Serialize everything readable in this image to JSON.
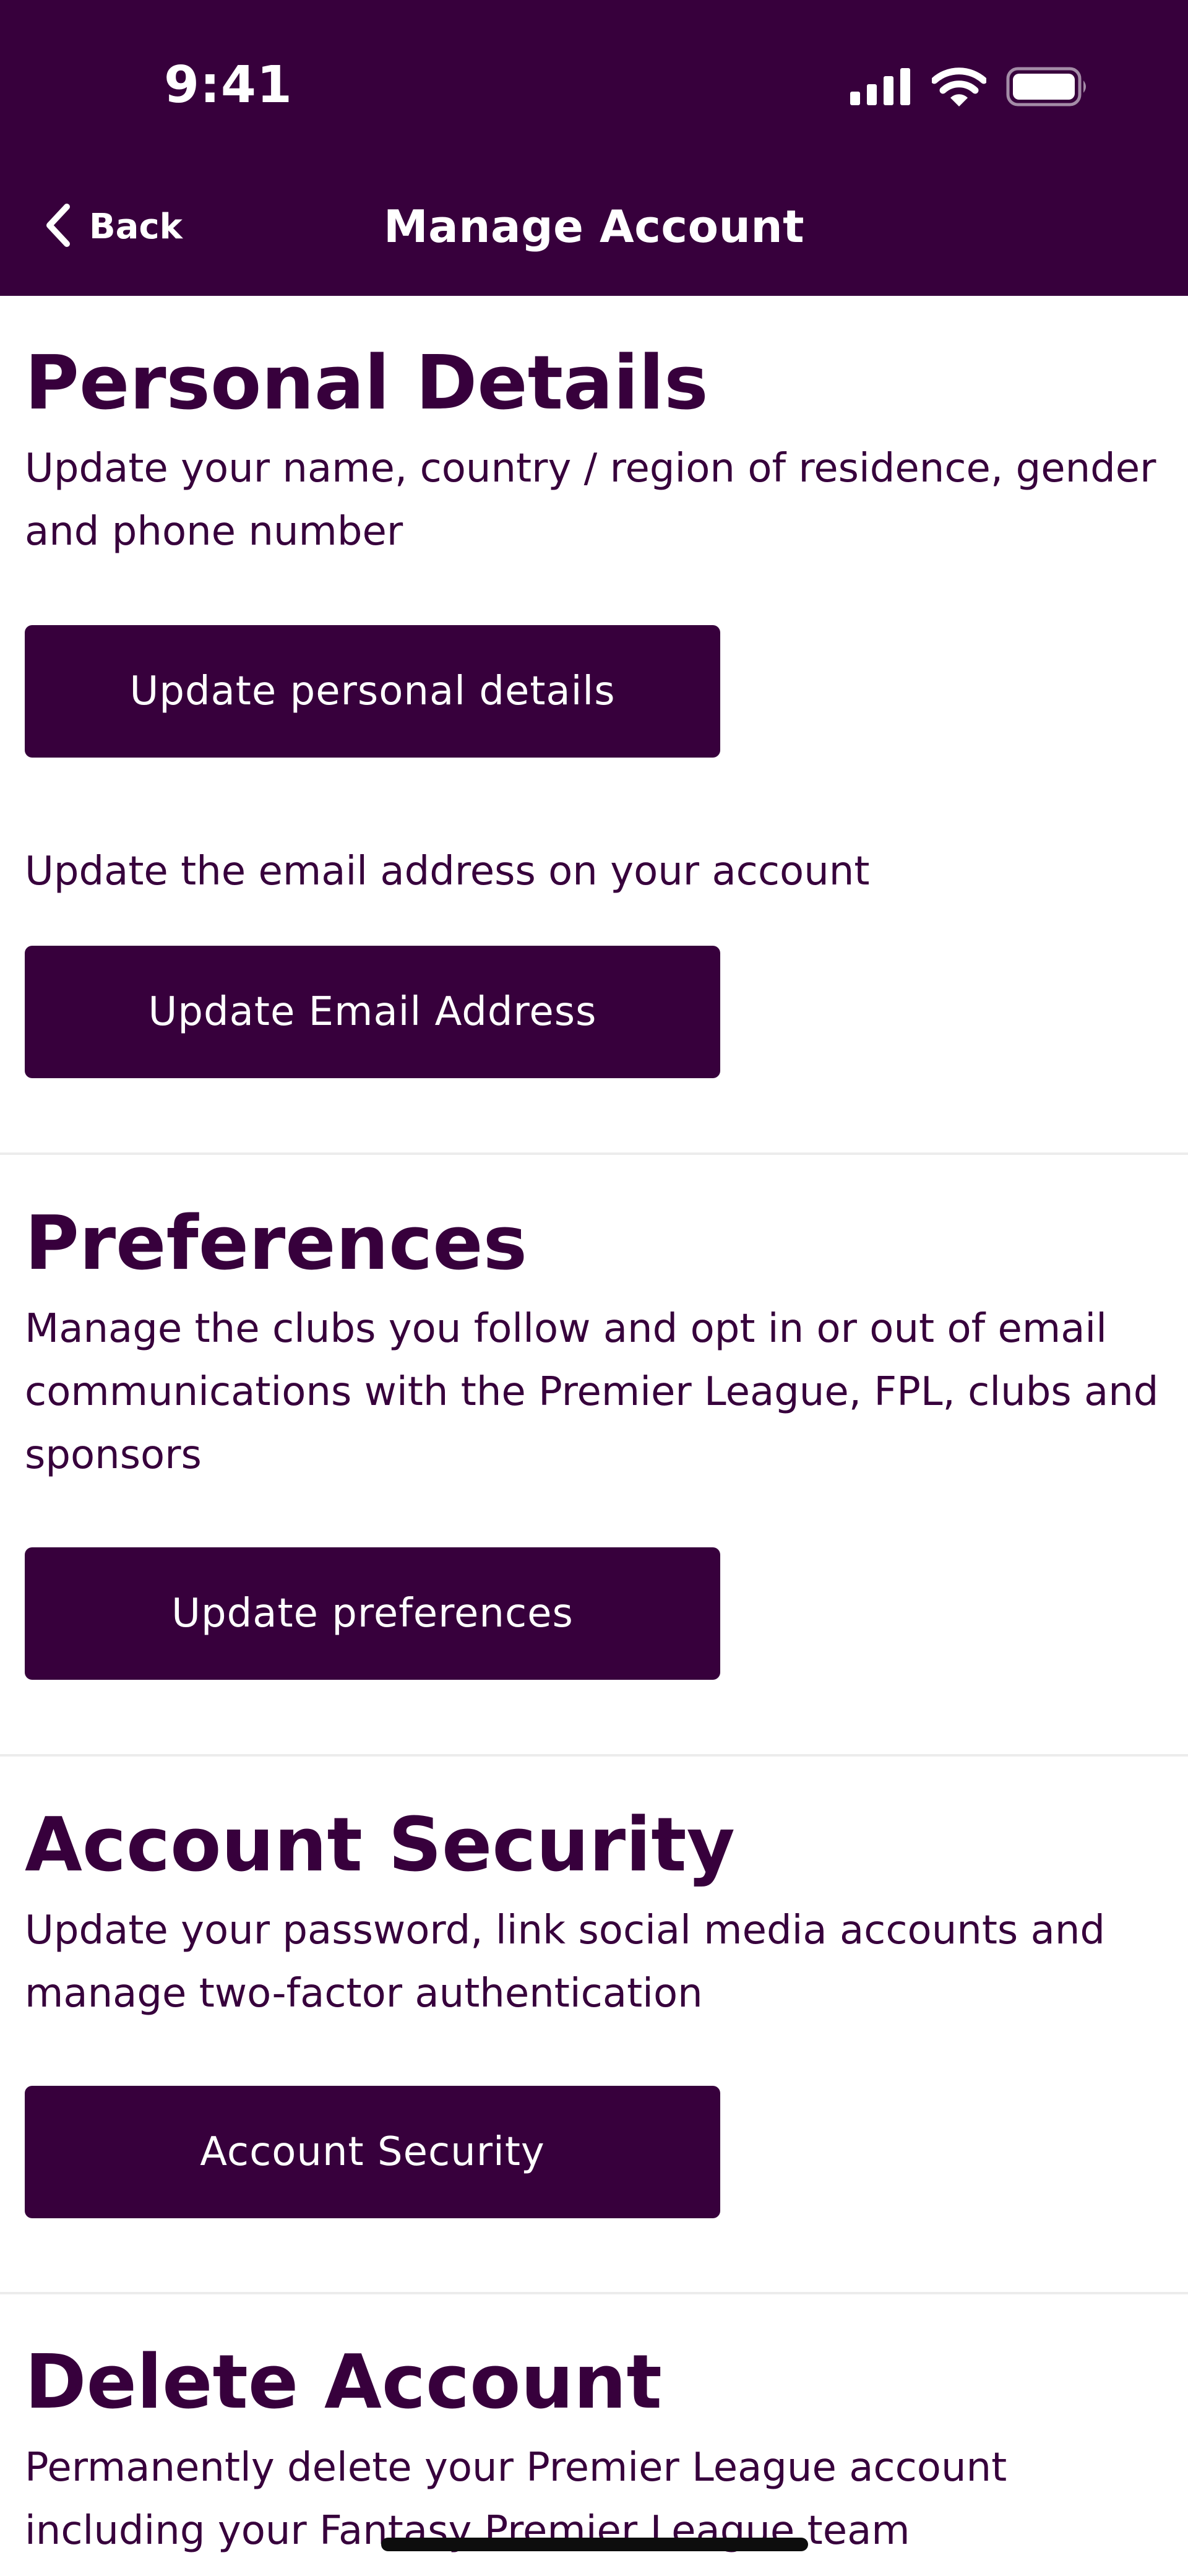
{
  "status_bar": {
    "time": "9:41"
  },
  "nav": {
    "back_label": "Back",
    "title": "Manage Account"
  },
  "sections": {
    "personal": {
      "title": "Personal Details",
      "description": "Update your name, country / region of residence, gender and phone number",
      "button_label": "Update personal details",
      "email_description": "Update the email address on your account",
      "email_button_label": "Update Email Address"
    },
    "preferences": {
      "title": "Preferences",
      "description": "Manage the clubs you follow and opt in or out of email communications with the Premier League, FPL, clubs and sponsors",
      "button_label": "Update preferences"
    },
    "security": {
      "title": "Account Security",
      "description": "Update your password, link social media accounts and manage two-factor authentication",
      "button_label": "Account Security"
    },
    "delete": {
      "title": "Delete Account",
      "description": "Permanently delete your Premier League account including your Fantasy Premier League team"
    }
  },
  "icons": {
    "back": "chevron-left-icon",
    "signal": "cellular-signal-icon",
    "wifi": "wifi-icon",
    "battery": "battery-icon"
  },
  "colors": {
    "brand_purple": "#37003c",
    "button_text": "#ffffff",
    "background": "#ffffff",
    "divider": "#ececec"
  }
}
